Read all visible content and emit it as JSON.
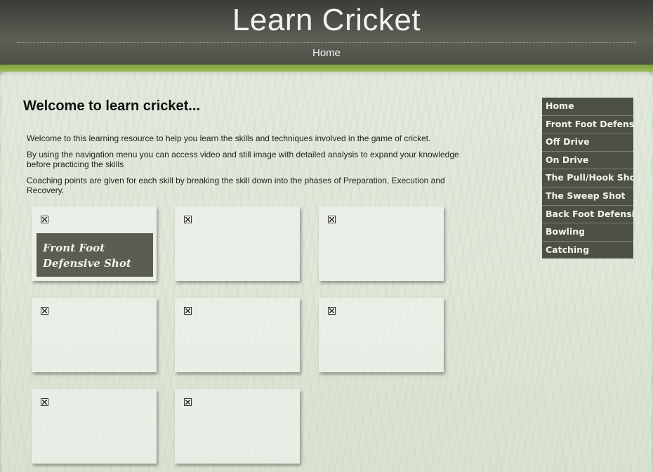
{
  "site": {
    "title": "Learn Cricket"
  },
  "top_nav": {
    "home": "Home"
  },
  "main": {
    "heading": "Welcome to learn cricket...",
    "paragraphs": [
      "Welcome to this learning resource to help you learn the skills and techniques involved in the game of cricket.",
      "By using the navigation menu you can access video and still image with detailed analysis to expand your knowledge before practicing the skills",
      "Coaching points are given for each skill by breaking the skill down into the phases of Preparation, Execution and Recovery."
    ],
    "tiles": [
      {
        "caption_line1": "Front Foot",
        "caption_line2": "Defensive Shot"
      }
    ]
  },
  "side_nav": {
    "items": [
      "Home",
      "Front Foot Defensive",
      "Off Drive",
      "On Drive",
      "The Pull/Hook Shot",
      "The Sweep Shot",
      "Back Foot Defensive",
      "Bowling",
      "Catching"
    ]
  },
  "colors": {
    "header_bg": "#4a4e45",
    "accent_green": "#8cae48",
    "side_nav_bg": "#4d5045"
  }
}
